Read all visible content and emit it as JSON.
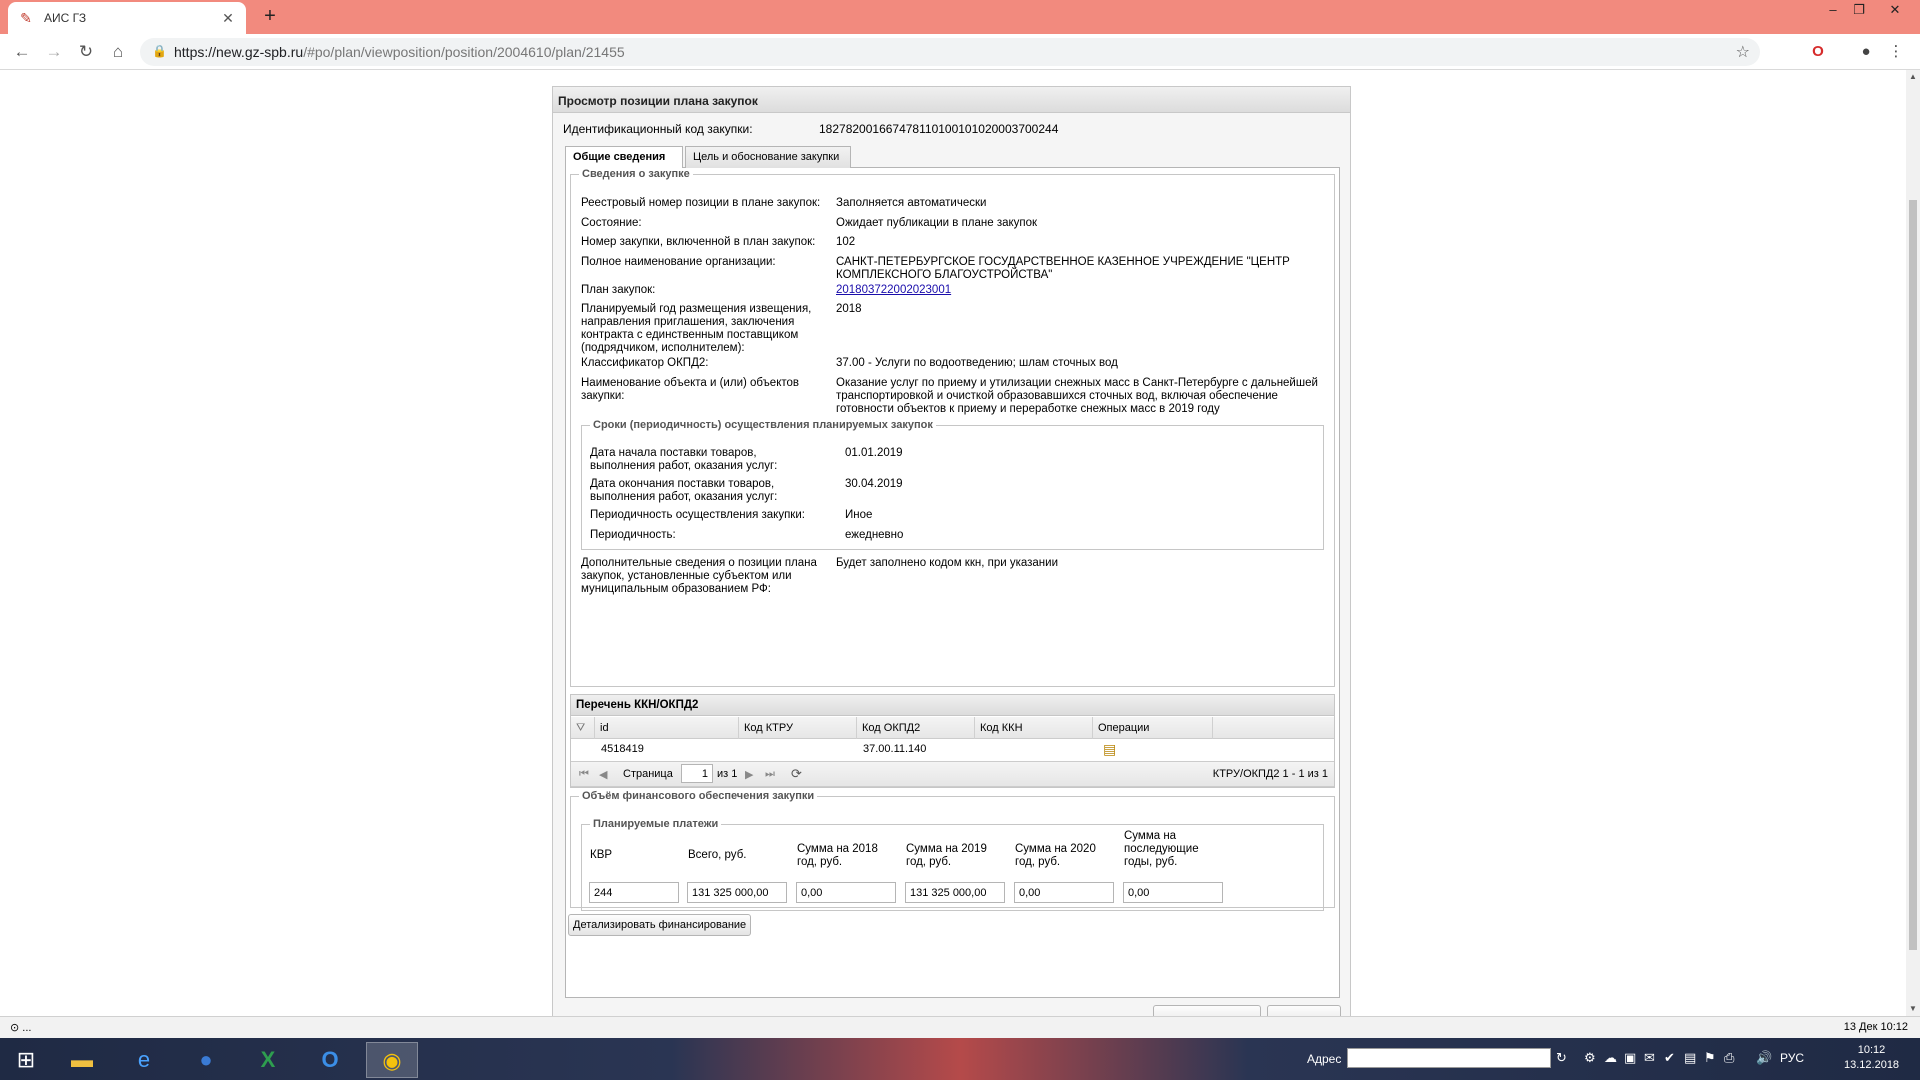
{
  "browser": {
    "tab_title": "АИС ГЗ",
    "url_host": "https://new.gz-spb.ru",
    "url_path": "/#po/plan/viewposition/position/2004610/plan/21455"
  },
  "panel": {
    "title": "Просмотр позиции плана закупок",
    "id_label": "Идентификационный код закупки:",
    "id_value": "182782001667478110100101020003700244",
    "tabs": [
      {
        "label": "Общие сведения",
        "active": true
      },
      {
        "label": "Цель и обоснование закупки",
        "active": false
      }
    ]
  },
  "general": {
    "legend": "Сведения о закупке",
    "fields": [
      {
        "label": "Реестровый номер позиции в плане закупок:",
        "value": "Заполняется автоматически"
      },
      {
        "label": "Состояние:",
        "value": "Ожидает публикации в плане закупок"
      },
      {
        "label": "Номер закупки, включенной в план закупок:",
        "value": "102"
      },
      {
        "label": "Полное наименование организации:",
        "value": "САНКТ-ПЕТЕРБУРГСКОЕ ГОСУДАРСТВЕННОЕ КАЗЕННОЕ УЧРЕЖДЕНИЕ \"ЦЕНТР КОМПЛЕКСНОГО БЛАГОУСТРОЙСТВА\""
      },
      {
        "label": "План закупок:",
        "value": "201803722002023001"
      },
      {
        "label": "Планируемый год размещения извещения, направления приглашения, заключения контракта с единственным поставщиком (подрядчиком, исполнителем):",
        "value": "2018"
      },
      {
        "label": "Классификатор ОКПД2:",
        "value": "37.00 - Услуги по водоотведению; шлам сточных вод"
      },
      {
        "label": "Наименование объекта и (или) объектов закупки:",
        "value": "Оказание услуг по приему и утилизации снежных масс в Санкт-Петербурге с дальнейшей транспортировкой и очисткой образовавшихся сточных вод, включая обеспечение готовности объектов к приему и переработке снежных масс в 2019 году"
      }
    ]
  },
  "terms": {
    "legend": "Сроки (периодичность) осуществления планируемых закупок",
    "fields": [
      {
        "label": "Дата начала поставки товаров, выполнения работ, оказания услуг:",
        "value": "01.01.2019"
      },
      {
        "label": "Дата окончания поставки товаров, выполнения работ, оказания услуг:",
        "value": "30.04.2019"
      },
      {
        "label": "Периодичность осуществления закупки:",
        "value": "Иное"
      },
      {
        "label": "Периодичность:",
        "value": "ежедневно"
      }
    ]
  },
  "extra": {
    "label": "Дополнительные сведения о позиции плана закупок, установленные субъектом или муниципальным образованием РФ:",
    "value": "Будет заполнено кодом ккн, при указании"
  },
  "kkn": {
    "title": "Перечень ККН/ОКПД2",
    "columns": [
      "id",
      "Код КТРУ",
      "Код ОКПД2",
      "Код ККН",
      "Операции"
    ],
    "rows": [
      {
        "id": "4518419",
        "ktru": "",
        "okpd2": "37.00.11.140",
        "kkn": ""
      }
    ],
    "pager": {
      "page_label": "Страница",
      "page": "1",
      "of": "из 1",
      "summary": "КТРУ/ОКПД2 1 - 1 из 1"
    }
  },
  "finance": {
    "legend": "Объём финансового обеспечения закупки",
    "sub_legend": "Планируемые платежи",
    "columns": [
      "КВР",
      "Всего, руб.",
      "Сумма на 2018 год, руб.",
      "Сумма на 2019 год, руб.",
      "Сумма на 2020 год, руб.",
      "Сумма на последующие годы, руб."
    ],
    "values": [
      "244",
      "131 325 000,00",
      "0,00",
      "131 325 000,00",
      "0,00",
      "0,00"
    ],
    "detail_button": "Детализировать финансирование"
  },
  "status": {
    "left": "⊙ ...",
    "right": "13 Дек 10:12"
  },
  "taskbar": {
    "address_label": "Адрес",
    "lang": "РУС",
    "time": "10:12",
    "date": "13.12.2018"
  }
}
